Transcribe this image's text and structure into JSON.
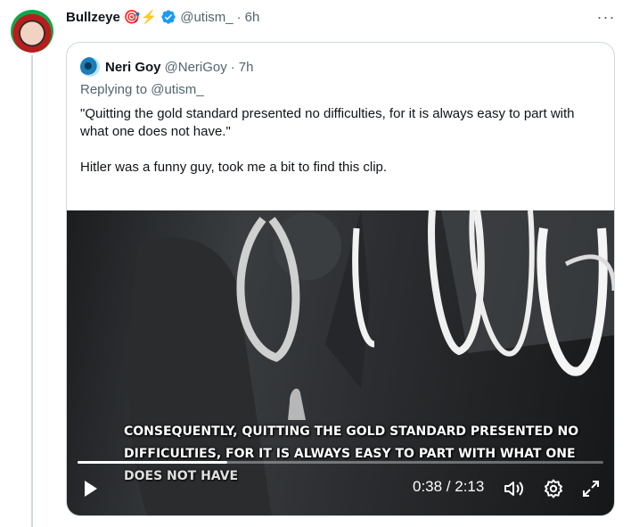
{
  "tweet": {
    "author_name": "Bullzeye",
    "author_emojis": "🎯⚡",
    "handle": "@utism_",
    "separator": "·",
    "time": "6h",
    "more_label": "···"
  },
  "quote": {
    "author_name": "Neri Goy",
    "handle": "@NeriGoy",
    "separator": "·",
    "time": "7h",
    "replying_label": "Replying to",
    "replying_handle": "@utism_",
    "text_line1": "\"Quitting the gold standard presented no difficulties, for it is always easy to part with what one does not have.\"",
    "text_line2": "Hitler was a funny guy, took me a bit to find this clip."
  },
  "video": {
    "caption_line1": "CONSEQUENTLY, QUITTING THE GOLD STANDARD PRESENTED NO",
    "caption_line2": "DIFFICULTIES, FOR IT IS ALWAYS EASY TO PART WITH WHAT ONE",
    "caption_line3": "DOES NOT HAVE",
    "time_display": "0:38 / 2:13",
    "progress_fraction": 0.285
  },
  "colors": {
    "text": "#0f1419",
    "muted": "#536471",
    "verified": "#1d9bf0",
    "border": "#cfd9de"
  },
  "icons": {
    "verified": "verified-badge-icon",
    "play": "play-icon",
    "volume": "volume-icon",
    "settings": "gear-icon",
    "fullscreen": "fullscreen-icon",
    "more": "more-icon"
  }
}
